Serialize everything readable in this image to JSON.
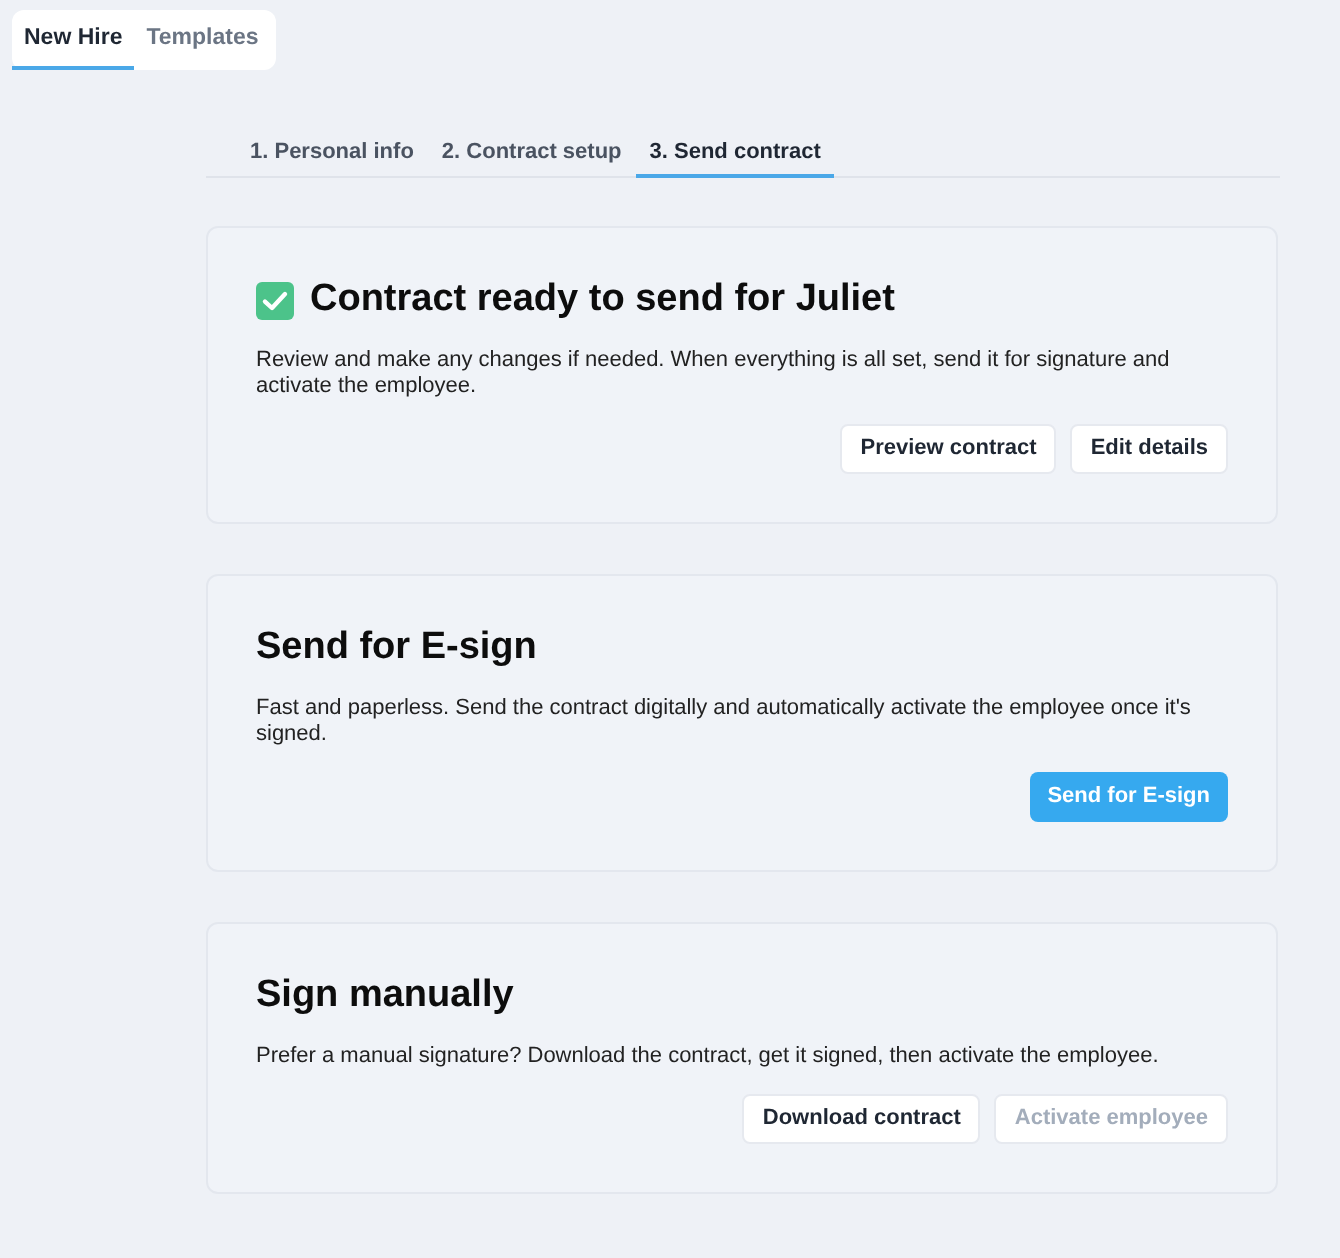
{
  "top_tabs": [
    {
      "label": "New Hire",
      "selected": true
    },
    {
      "label": "Templates",
      "selected": false
    }
  ],
  "steps": [
    {
      "label": "1. Personal info",
      "selected": false
    },
    {
      "label": "2. Contract setup",
      "selected": false
    },
    {
      "label": "3. Send contract",
      "selected": true
    }
  ],
  "cards": [
    {
      "kind": "status",
      "title": "Contract ready to send for Juliet",
      "description": "Review and make any changes if needed. When everything is all set, send it for signature and activate the employee.",
      "buttons": [
        {
          "label": "Preview contract",
          "kind": "secondary",
          "disabled": false
        },
        {
          "label": "Edit details",
          "kind": "secondary",
          "disabled": false
        }
      ]
    },
    {
      "kind": "option",
      "title": "Send for E-sign",
      "description": "Fast and paperless. Send the contract digitally and automatically activate the employee once it's signed.",
      "buttons": [
        {
          "label": "Send for E-sign",
          "kind": "primary",
          "disabled": false
        }
      ]
    },
    {
      "kind": "option",
      "title": "Sign manually",
      "description": "Prefer a manual signature? Download the contract, get it signed, then activate the employee.",
      "buttons": [
        {
          "label": "Download contract",
          "kind": "secondary",
          "disabled": false
        },
        {
          "label": "Activate employee",
          "kind": "secondary",
          "disabled": true
        }
      ]
    }
  ]
}
